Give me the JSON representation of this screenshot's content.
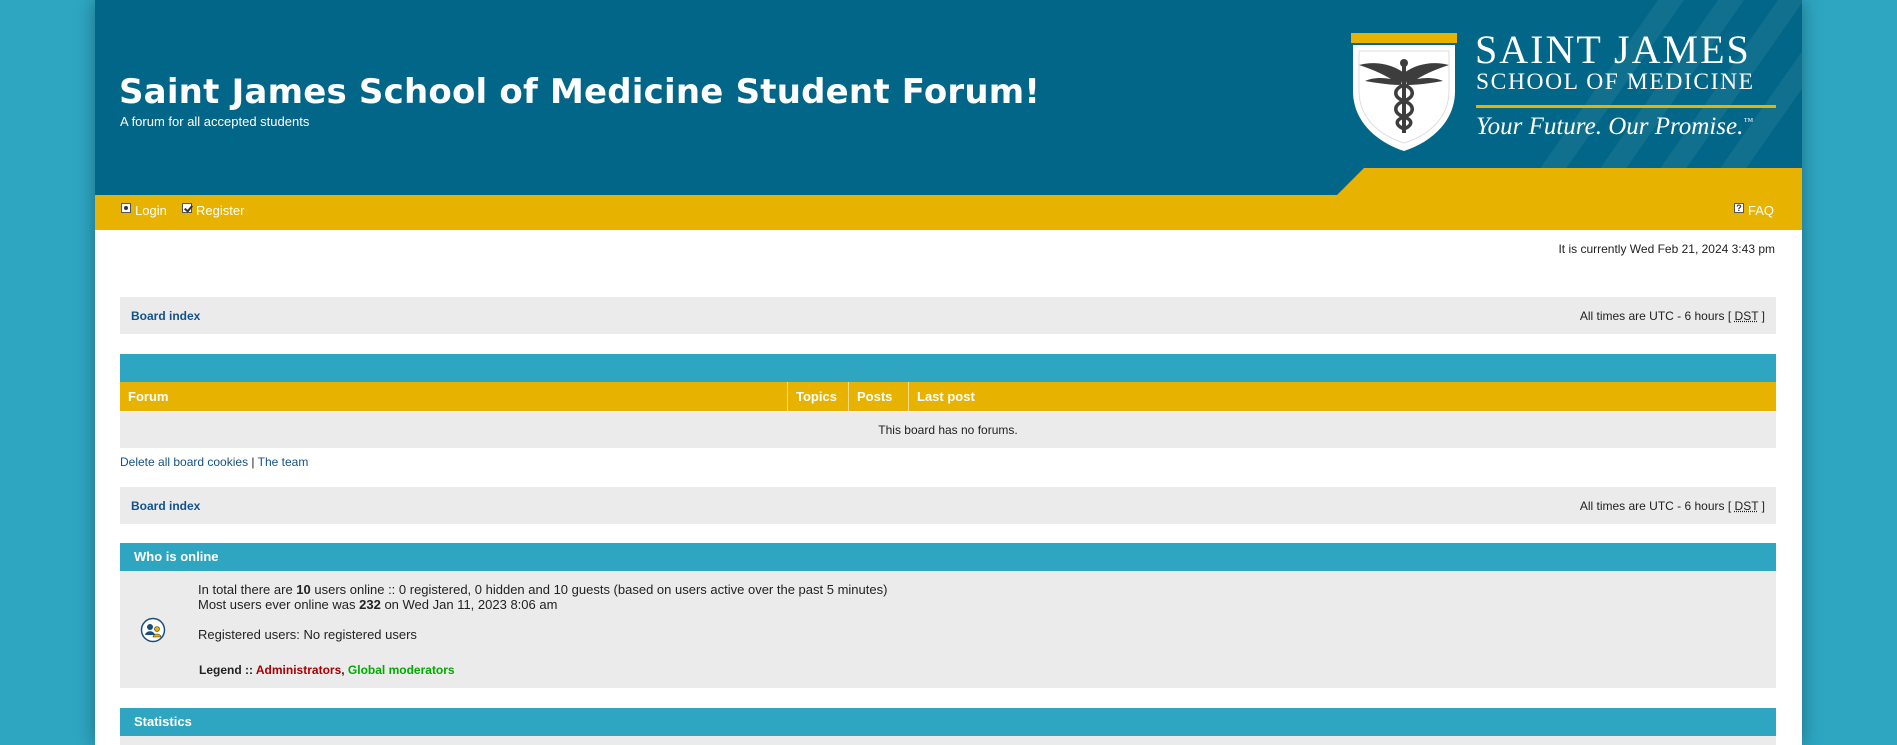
{
  "header": {
    "site_title": "Saint James School of Medicine Student Forum!",
    "site_description": "A forum for all accepted students",
    "logo": {
      "line1": "SAINT JAMES",
      "line2": "SCHOOL OF MEDICINE",
      "tagline": "Your Future. Our Promise.",
      "trademark": "™",
      "icon": "caduceus-shield-icon"
    }
  },
  "nav": {
    "login": "Login",
    "register": "Register",
    "faq": "FAQ",
    "icons": {
      "login": "lock-icon",
      "register": "checkbox-icon",
      "faq": "help-icon"
    }
  },
  "current_time": "It is currently Wed Feb 21, 2024 3:43 pm",
  "breadcrumb": {
    "board_index": "Board index",
    "timezone_prefix": "All times are UTC - 6 hours [ ",
    "dst": "DST",
    "timezone_suffix": " ]"
  },
  "forum_table": {
    "columns": [
      "Forum",
      "Topics",
      "Posts",
      "Last post"
    ],
    "empty_message": "This board has no forums."
  },
  "footer_links": {
    "delete_cookies": "Delete all board cookies",
    "separator": " | ",
    "team": "The team"
  },
  "who_is_online": {
    "title": "Who is online",
    "total_prefix": "In total there are ",
    "total_count": "10",
    "total_suffix": " users online :: 0 registered, 0 hidden and 10 guests (based on users active over the past 5 minutes)",
    "max_prefix": "Most users ever online was ",
    "max_count": "232",
    "max_suffix": " on Wed Jan 11, 2023 8:06 am",
    "registered_users": "Registered users: No registered users",
    "legend_label": "Legend :: ",
    "legend_admins": "Administrators",
    "legend_sep": ", ",
    "legend_gmods": "Global moderators"
  },
  "statistics": {
    "title": "Statistics"
  },
  "colors": {
    "page_bg": "#2ea6c2",
    "header_bg": "#016687",
    "accent_gold": "#e8b200",
    "section_teal": "#2ea6c2",
    "row_gray": "#ebebeb",
    "link_blue": "#105289",
    "admin_red": "#aa0000",
    "gmod_green": "#00aa00"
  }
}
